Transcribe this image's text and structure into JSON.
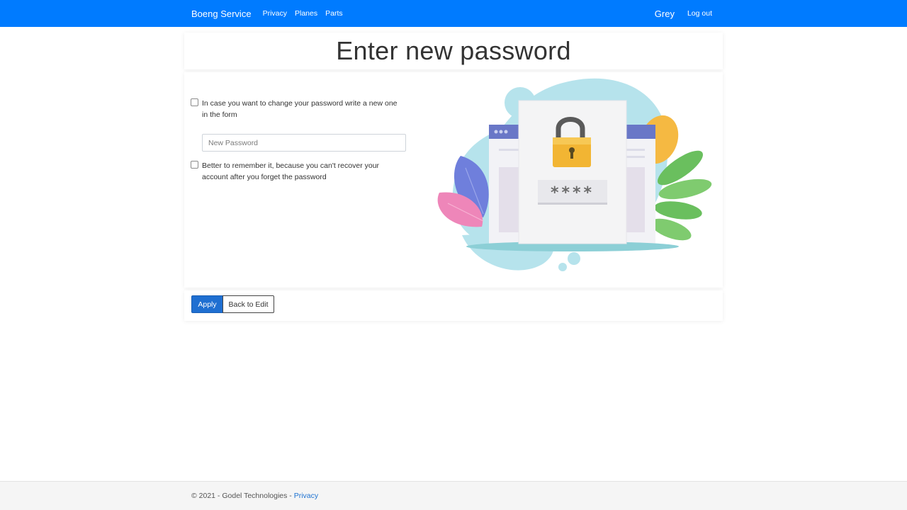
{
  "navbar": {
    "brand": "Boeng Service",
    "links": [
      "Privacy",
      "Planes",
      "Parts"
    ],
    "user": "Grey",
    "logout": "Log out"
  },
  "page": {
    "title": "Enter new password"
  },
  "form": {
    "change_checkbox_label": "In case you want to change your password write a new one in the form",
    "password_placeholder": "New Password",
    "password_value": "",
    "remember_checkbox_label": "Better to remember it, because you can't recover your account after you forget the password",
    "password_mask": "****"
  },
  "buttons": {
    "apply": "Apply",
    "back": "Back to Edit"
  },
  "footer": {
    "copyright": "© 2021 - Godel Technologies - ",
    "privacy_link": "Privacy"
  },
  "colors": {
    "navbar": "#007bff",
    "primary_button": "#1f6fd1",
    "footer_bg": "#f5f5f5"
  }
}
